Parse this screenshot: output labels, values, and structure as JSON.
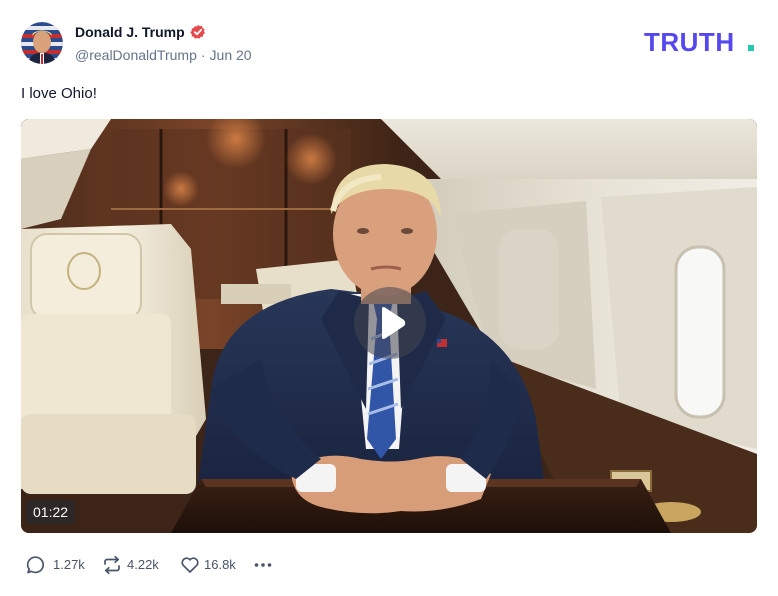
{
  "post": {
    "author": {
      "name": "Donald J. Trump",
      "handle": "@realDonaldTrump",
      "date": "Jun 20",
      "verified": true,
      "badge_color": "#e5484d"
    },
    "brand": {
      "logo_text": "TRUTH.",
      "color": "#5448ee",
      "dot_color": "#22c9b0"
    },
    "text": "I love Ohio!",
    "video": {
      "duration": "01:22",
      "play_icon": "play-icon"
    },
    "actions": {
      "replies": "1.27k",
      "retruths": "4.22k",
      "likes": "16.8k",
      "icons": [
        "reply-icon",
        "retruth-icon",
        "like-icon",
        "more-icon"
      ]
    }
  }
}
